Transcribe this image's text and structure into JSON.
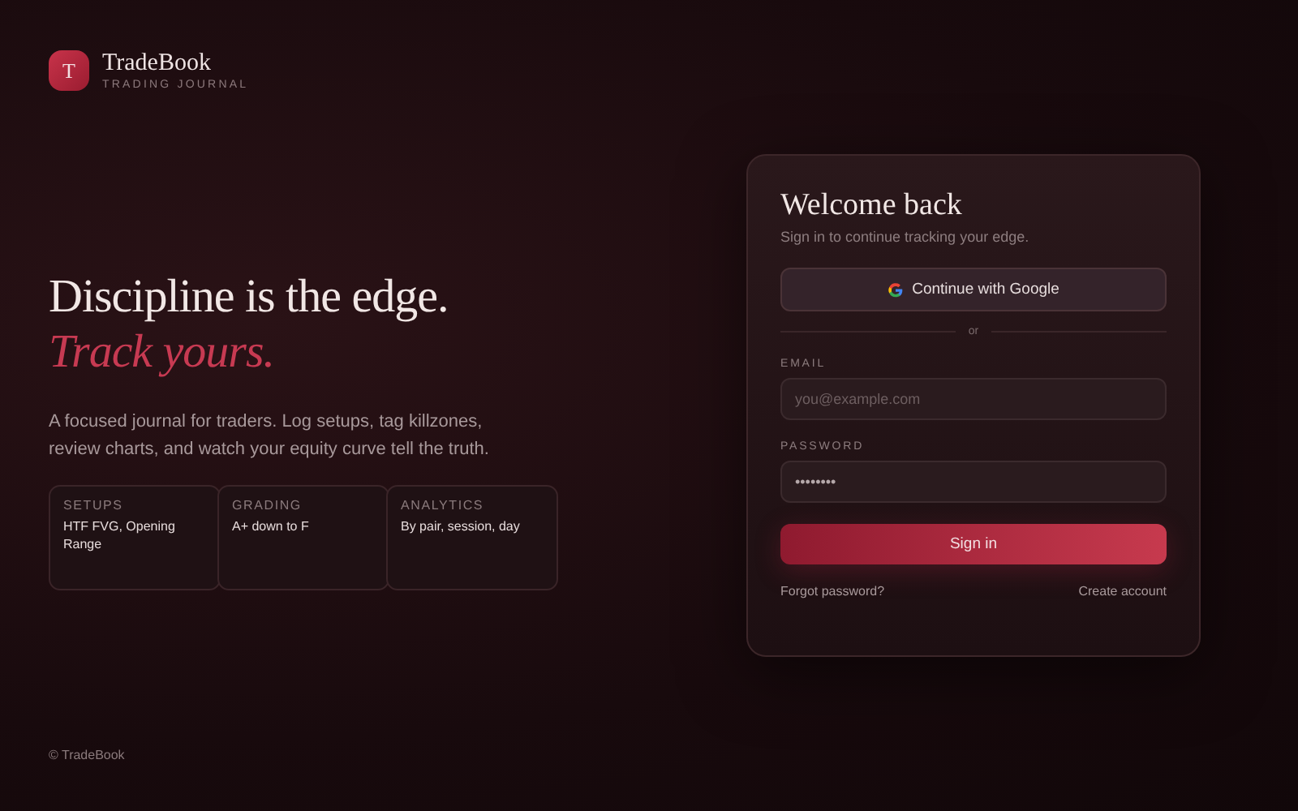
{
  "brand": {
    "logo_letter": "T",
    "name": "TradeBook",
    "tagline": "TRADING JOURNAL"
  },
  "hero": {
    "headline": "Discipline is the edge.",
    "accent": "Track yours.",
    "description": "A focused journal for traders. Log setups, tag killzones, review charts, and watch your equity curve tell the truth."
  },
  "features": [
    {
      "label": "SETUPS",
      "value": "HTF FVG, Opening Range"
    },
    {
      "label": "GRADING",
      "value": "A+ down to F"
    },
    {
      "label": "ANALYTICS",
      "value": "By pair, session, day"
    }
  ],
  "footer": "© TradeBook",
  "login": {
    "title": "Welcome back",
    "subtitle": "Sign in to continue tracking your edge.",
    "google_button": "Continue with Google",
    "divider": "or",
    "fields": [
      {
        "label": "EMAIL",
        "placeholder": "you@example.com"
      },
      {
        "label": "PASSWORD",
        "value": "••••••••"
      }
    ],
    "submit": "Sign in",
    "links": [
      "Forgot password?",
      "Create account"
    ]
  }
}
